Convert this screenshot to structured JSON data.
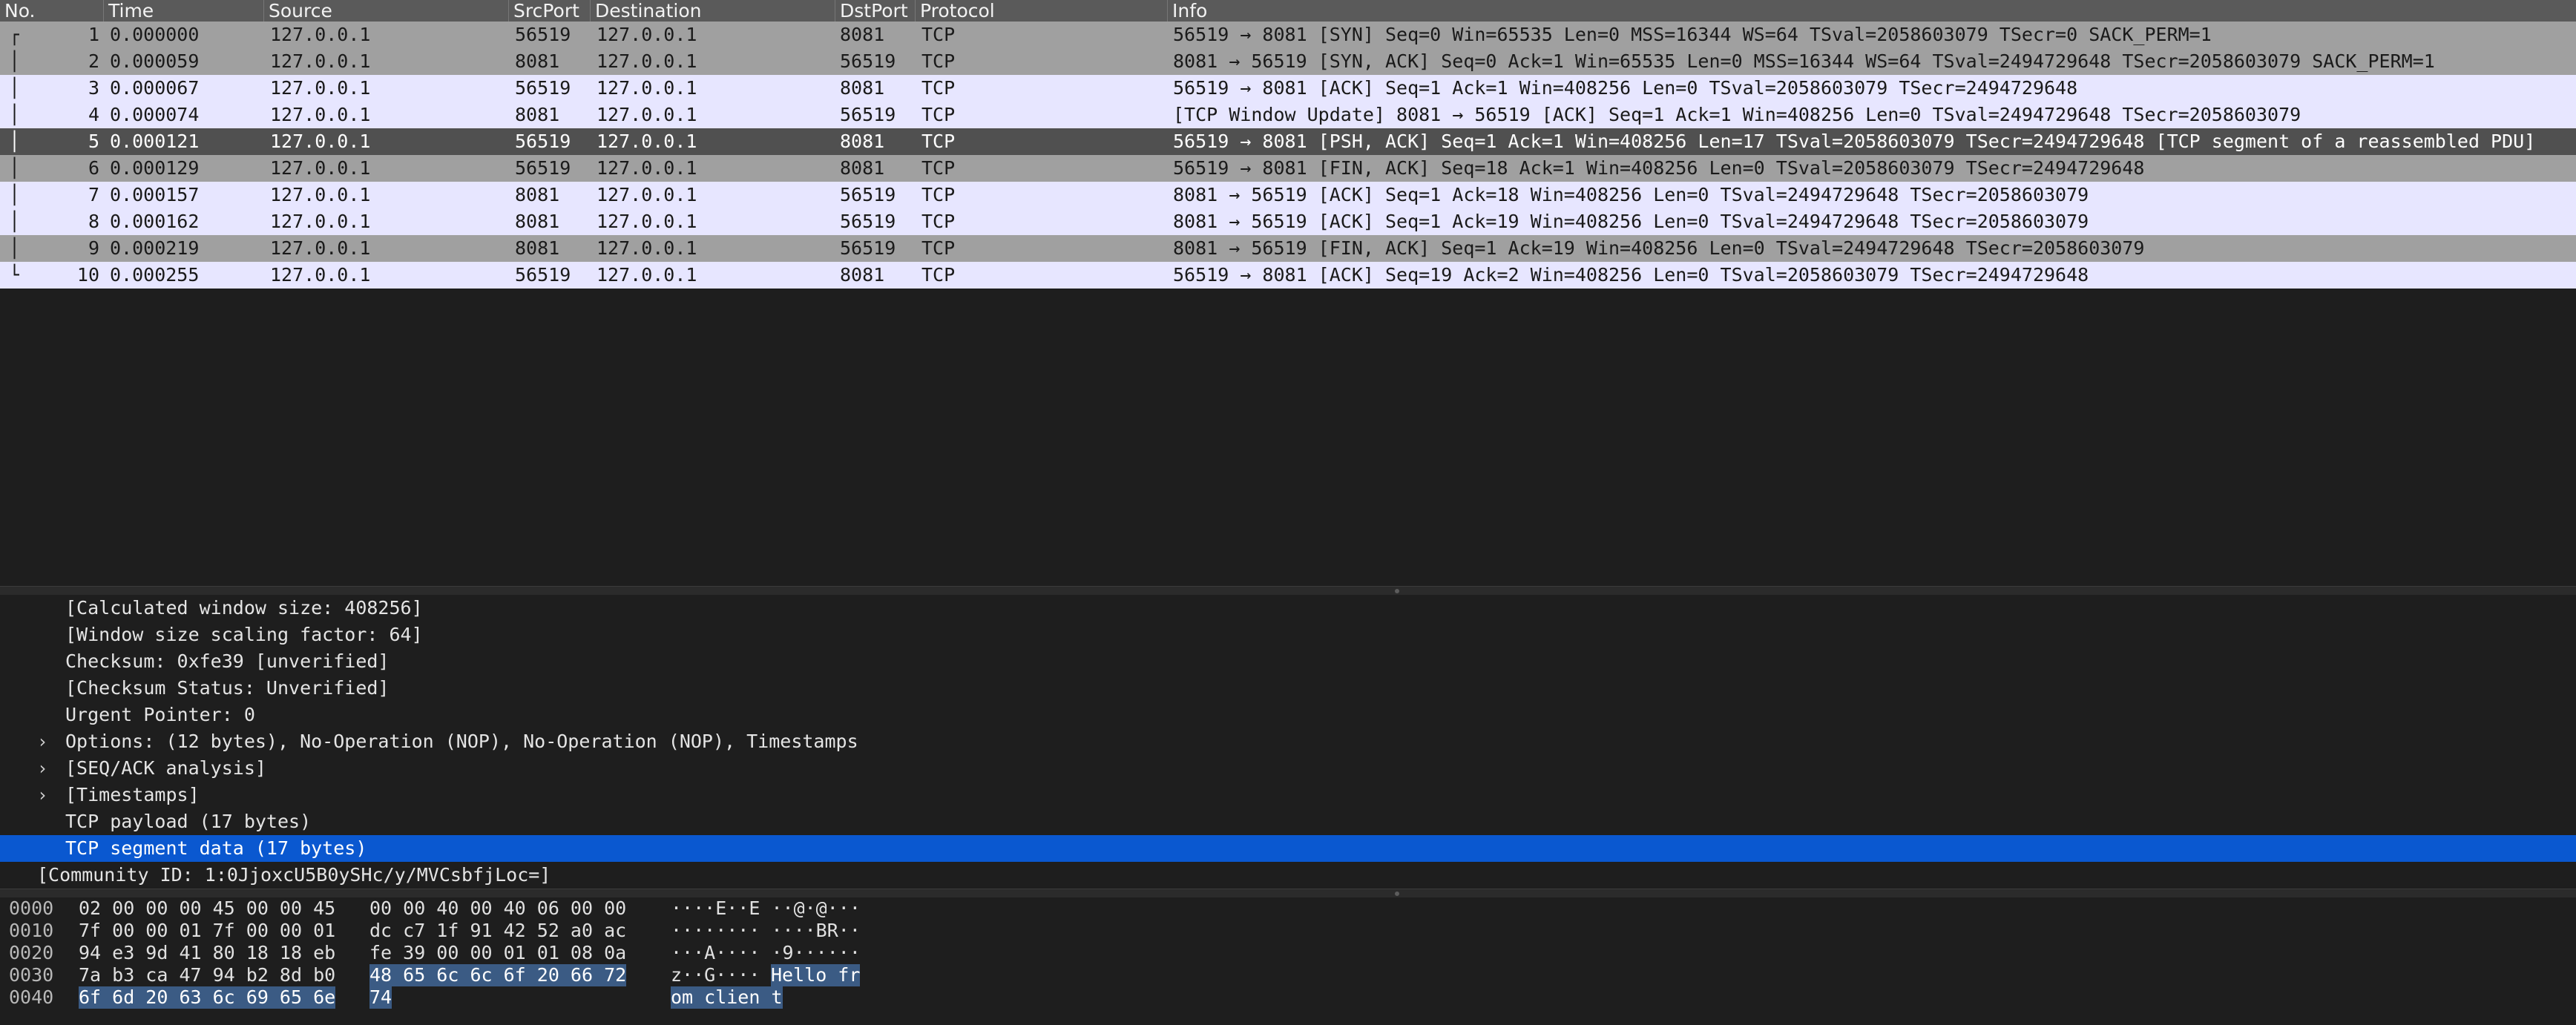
{
  "packet_list": {
    "columns": [
      "No.",
      "Time",
      "Source",
      "SrcPort",
      "Destination",
      "DstPort",
      "Protocol",
      "Info"
    ],
    "rows": [
      {
        "no": "1",
        "time": "0.000000",
        "src": "127.0.0.1",
        "sport": "56519",
        "dst": "127.0.0.1",
        "dport": "8081",
        "proto": "TCP",
        "info": "56519 → 8081 [SYN] Seq=0 Win=65535 Len=0 MSS=16344 WS=64 TSval=2058603079 TSecr=0 SACK_PERM=1",
        "color": "gray",
        "bracket": "┌"
      },
      {
        "no": "2",
        "time": "0.000059",
        "src": "127.0.0.1",
        "sport": "8081",
        "dst": "127.0.0.1",
        "dport": "56519",
        "proto": "TCP",
        "info": "8081 → 56519 [SYN, ACK] Seq=0 Ack=1 Win=65535 Len=0 MSS=16344 WS=64 TSval=2494729648 TSecr=2058603079 SACK_PERM=1",
        "color": "gray",
        "bracket": "│"
      },
      {
        "no": "3",
        "time": "0.000067",
        "src": "127.0.0.1",
        "sport": "56519",
        "dst": "127.0.0.1",
        "dport": "8081",
        "proto": "TCP",
        "info": "56519 → 8081 [ACK] Seq=1 Ack=1 Win=408256 Len=0 TSval=2058603079 TSecr=2494729648",
        "color": "lav",
        "bracket": "│"
      },
      {
        "no": "4",
        "time": "0.000074",
        "src": "127.0.0.1",
        "sport": "8081",
        "dst": "127.0.0.1",
        "dport": "56519",
        "proto": "TCP",
        "info": "[TCP Window Update] 8081 → 56519 [ACK] Seq=1 Ack=1 Win=408256 Len=0 TSval=2494729648 TSecr=2058603079",
        "color": "lav",
        "bracket": "│"
      },
      {
        "no": "5",
        "time": "0.000121",
        "src": "127.0.0.1",
        "sport": "56519",
        "dst": "127.0.0.1",
        "dport": "8081",
        "proto": "TCP",
        "info": "56519 → 8081 [PSH, ACK] Seq=1 Ack=1 Win=408256 Len=17 TSval=2058603079 TSecr=2494729648 [TCP segment of a reassembled PDU]",
        "color": "sel",
        "bracket": "│"
      },
      {
        "no": "6",
        "time": "0.000129",
        "src": "127.0.0.1",
        "sport": "56519",
        "dst": "127.0.0.1",
        "dport": "8081",
        "proto": "TCP",
        "info": "56519 → 8081 [FIN, ACK] Seq=18 Ack=1 Win=408256 Len=0 TSval=2058603079 TSecr=2494729648",
        "color": "gray",
        "bracket": "│"
      },
      {
        "no": "7",
        "time": "0.000157",
        "src": "127.0.0.1",
        "sport": "8081",
        "dst": "127.0.0.1",
        "dport": "56519",
        "proto": "TCP",
        "info": "8081 → 56519 [ACK] Seq=1 Ack=18 Win=408256 Len=0 TSval=2494729648 TSecr=2058603079",
        "color": "lav",
        "bracket": "│"
      },
      {
        "no": "8",
        "time": "0.000162",
        "src": "127.0.0.1",
        "sport": "8081",
        "dst": "127.0.0.1",
        "dport": "56519",
        "proto": "TCP",
        "info": "8081 → 56519 [ACK] Seq=1 Ack=19 Win=408256 Len=0 TSval=2494729648 TSecr=2058603079",
        "color": "lav",
        "bracket": "│"
      },
      {
        "no": "9",
        "time": "0.000219",
        "src": "127.0.0.1",
        "sport": "8081",
        "dst": "127.0.0.1",
        "dport": "56519",
        "proto": "TCP",
        "info": "8081 → 56519 [FIN, ACK] Seq=1 Ack=19 Win=408256 Len=0 TSval=2494729648 TSecr=2058603079",
        "color": "gray",
        "bracket": "│"
      },
      {
        "no": "10",
        "time": "0.000255",
        "src": "127.0.0.1",
        "sport": "56519",
        "dst": "127.0.0.1",
        "dport": "8081",
        "proto": "TCP",
        "info": "56519 → 8081 [ACK] Seq=19 Ack=2 Win=408256 Len=0 TSval=2058603079 TSecr=2494729648",
        "color": "lav",
        "bracket": "└"
      }
    ]
  },
  "details": {
    "rows": [
      {
        "text": "[Calculated window size: 408256]",
        "arrow": "",
        "indent": 1,
        "selected": false
      },
      {
        "text": "[Window size scaling factor: 64]",
        "arrow": "",
        "indent": 1,
        "selected": false
      },
      {
        "text": "Checksum: 0xfe39 [unverified]",
        "arrow": "",
        "indent": 1,
        "selected": false
      },
      {
        "text": "[Checksum Status: Unverified]",
        "arrow": "",
        "indent": 1,
        "selected": false
      },
      {
        "text": "Urgent Pointer: 0",
        "arrow": "",
        "indent": 1,
        "selected": false
      },
      {
        "text": "Options: (12 bytes), No-Operation (NOP), No-Operation (NOP), Timestamps",
        "arrow": "›",
        "indent": 1,
        "selected": false
      },
      {
        "text": "[SEQ/ACK analysis]",
        "arrow": "›",
        "indent": 1,
        "selected": false
      },
      {
        "text": "[Timestamps]",
        "arrow": "›",
        "indent": 1,
        "selected": false
      },
      {
        "text": "TCP payload (17 bytes)",
        "arrow": "",
        "indent": 1,
        "selected": false
      },
      {
        "text": "TCP segment data (17 bytes)",
        "arrow": "",
        "indent": 1,
        "selected": true
      },
      {
        "text": "[Community ID: 1:0JjoxcU5B0ySHc/y/MVCsbfjLoc=]",
        "arrow": "",
        "indent": 0,
        "selected": false
      }
    ]
  },
  "bytes": {
    "rows": [
      {
        "offset": "0000",
        "hex1": "02 00 00 00 45 00 00 45",
        "hex2": "00 00 40 00 40 06 00 00",
        "ascii_plain": "····E··E ··@·@···",
        "hl_hex1": "",
        "hl_hex2": "",
        "hl_ascii": ""
      },
      {
        "offset": "0010",
        "hex1": "7f 00 00 01 7f 00 00 01",
        "hex2": "dc c7 1f 91 42 52 a0 ac",
        "ascii_plain": "········ ····BR··",
        "hl_hex1": "",
        "hl_hex2": "",
        "hl_ascii": ""
      },
      {
        "offset": "0020",
        "hex1": "94 e3 9d 41 80 18 18 eb",
        "hex2": "fe 39 00 00 01 01 08 0a",
        "ascii_plain": "···A···· ·9······",
        "hl_hex1": "",
        "hl_hex2": "",
        "hl_ascii": ""
      },
      {
        "offset": "0030",
        "hex1": "7a b3 ca 47 94 b2 8d b0",
        "hex2": "",
        "ascii_plain": "z··G···· ",
        "hl_hex1": "",
        "hl_hex2": "48 65 6c 6c 6f 20 66 72",
        "hl_ascii": "Hello fr"
      },
      {
        "offset": "0040",
        "hex1": "",
        "hex2": "",
        "ascii_plain": "",
        "hl_hex1": "6f 6d 20 63 6c 69 65 6e",
        "hl_hex2": "74",
        "hl_ascii": "om clien t"
      }
    ]
  },
  "colors": {
    "row_gray": "#a0a0a0",
    "row_lavender": "#e7e6ff",
    "row_selected": "#505050",
    "detail_selected": "#0a58d0",
    "byte_highlight": "#3b5b84"
  }
}
